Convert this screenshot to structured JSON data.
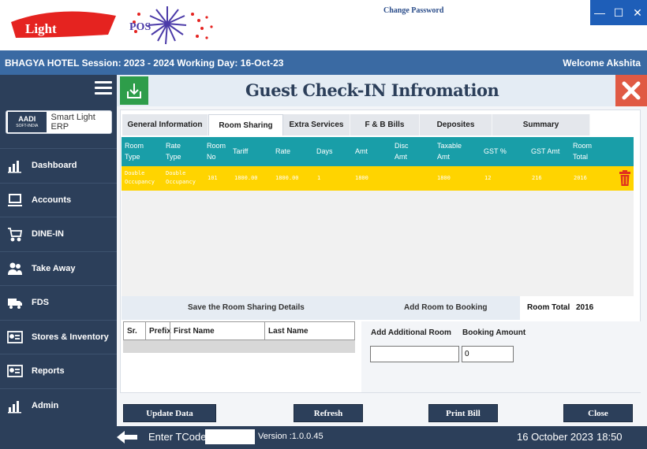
{
  "header": {
    "logo_text_1": "Light",
    "logo_text_2": "POS",
    "change_password": "Change Password",
    "window_controls": [
      "minimize-icon",
      "maximize-icon",
      "close-icon"
    ]
  },
  "session": {
    "info": "BHAGYA HOTEL  Session:  2023 - 2024 Working Day: 16-Oct-23",
    "welcome": "Welcome  Akshita"
  },
  "sidebar": {
    "brand_mark": "AADI",
    "brand_sub": "SOFT-INDIA",
    "brand_name": "Smart Light ERP",
    "items": [
      {
        "label": "Dashboard",
        "icon": "chart-icon"
      },
      {
        "label": "Accounts",
        "icon": "monitor-icon"
      },
      {
        "label": "DINE-IN",
        "icon": "cart-icon"
      },
      {
        "label": "Take Away",
        "icon": "users-icon"
      },
      {
        "label": "FDS",
        "icon": "truck-icon"
      },
      {
        "label": "Stores & Inventory",
        "icon": "id-card-icon"
      },
      {
        "label": "Reports",
        "icon": "id-card-icon"
      },
      {
        "label": "Admin",
        "icon": "chart-icon"
      }
    ]
  },
  "page": {
    "title": "Guest Check-IN Infromation",
    "tabs": [
      "General  Information",
      "Room Sharing",
      "Extra Services",
      "F & B Bills",
      "Deposites",
      "Summary"
    ],
    "active_tab": "Room Sharing"
  },
  "grid": {
    "columns": [
      "Room Type",
      "Rate Type",
      "Room No",
      "Tariff",
      "Rate",
      "Days",
      "Amt",
      "Disc Amt",
      "Taxable Amt",
      "GST %",
      "GST Amt",
      "Room Total"
    ],
    "rows": [
      {
        "room_type": "Double Occupancy",
        "rate_type": "Double Occupancy",
        "room_no": "101",
        "tariff": "1800.00",
        "rate": "1800.00",
        "days": "1",
        "amt": "1800",
        "disc_amt": "",
        "taxable_amt": "1800",
        "gst_pct": "12",
        "gst_amt": "216",
        "room_total": "2016"
      }
    ]
  },
  "room_sharing": {
    "save_label": "Save the Room Sharing Details",
    "add_room_label": "Add Room to Booking",
    "room_total_label": "Room Total",
    "room_total_value": "2016",
    "guest_columns": [
      "Sr.",
      "Prefix",
      "First Name",
      "Last Name"
    ],
    "add_additional_room_label": "Add Additional Room",
    "booking_amount_label": "Booking Amount",
    "add_additional_room_value": "",
    "booking_amount_value": "0"
  },
  "actions": {
    "update": "Update Data",
    "refresh": "Refresh",
    "print": "Print Bill",
    "close": "Close"
  },
  "footer": {
    "tcode_label": "Enter TCode",
    "tcode_value": "",
    "version": "Version :1.0.0.45",
    "date": "16 October 2023",
    "time": "18:50"
  },
  "colors": {
    "sidebar": "#2c3f5a",
    "session_bar": "#3a6aa3",
    "grid_header": "#199ea8",
    "grid_row": "#ffd400",
    "save_green": "#2e9d4a",
    "close_red": "#e05a44",
    "trash_red": "#e0321e"
  }
}
